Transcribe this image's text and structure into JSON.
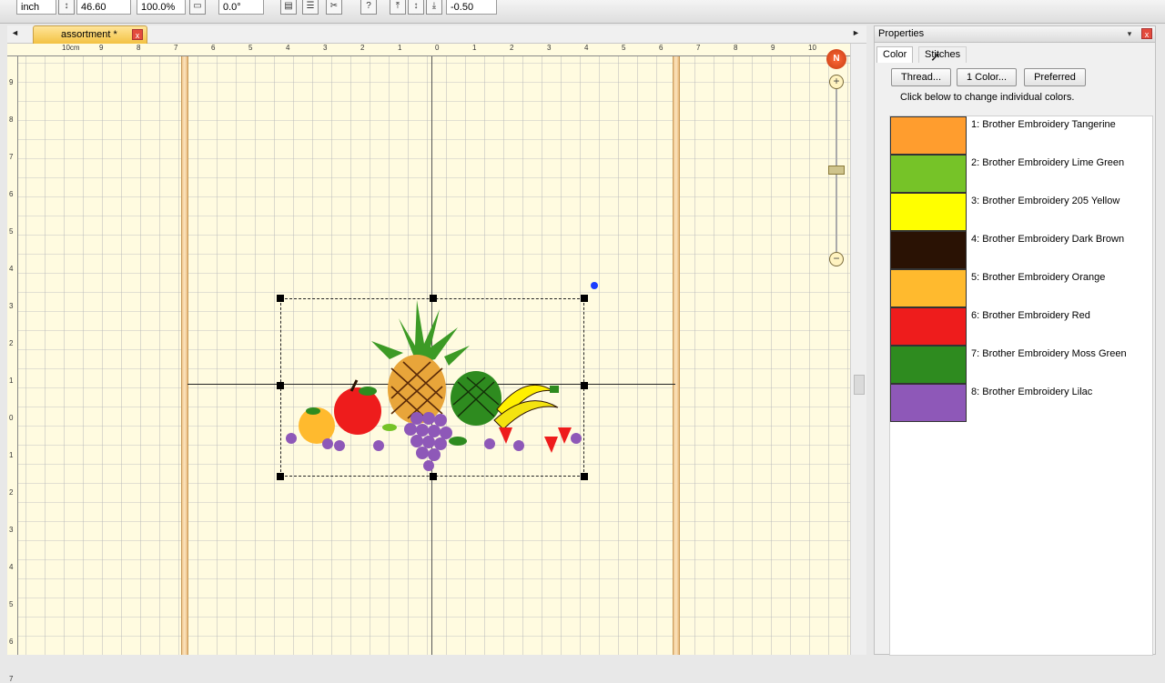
{
  "toolbar": {
    "unit_label": "inch",
    "field_width": "46.60",
    "field_zoom": "100.0%",
    "field_angle": "0.0°",
    "field_offset": "-0.50"
  },
  "document": {
    "tab_title": "assortment *",
    "tab_close": "x"
  },
  "ruler": {
    "top_ticks": [
      "10cm",
      "9",
      "8",
      "7",
      "6",
      "5",
      "4",
      "3",
      "2",
      "1",
      "0",
      "1",
      "2",
      "3",
      "4",
      "5",
      "6",
      "7",
      "8",
      "9",
      "10"
    ],
    "left_ticks": [
      "9",
      "8",
      "7",
      "6",
      "5",
      "4",
      "3",
      "2",
      "1",
      "0",
      "1",
      "2",
      "3",
      "4",
      "5",
      "6",
      "7"
    ]
  },
  "zoom": {
    "plus": "+",
    "minus": "−",
    "north": "N"
  },
  "properties": {
    "title": "Properties",
    "tabs": {
      "color": "Color",
      "stitches": "Stitches"
    },
    "buttons": {
      "thread": "Thread...",
      "one_color": "1 Color...",
      "preferred": "Preferred"
    },
    "hint": "Click below to change individual colors.",
    "colors": [
      {
        "label": "1: Brother Embroidery Tangerine",
        "hex": "#ff9d2e"
      },
      {
        "label": "2: Brother Embroidery Lime Green",
        "hex": "#76c328"
      },
      {
        "label": "3: Brother Embroidery 205 Yellow",
        "hex": "#ffff00"
      },
      {
        "label": "4: Brother Embroidery Dark Brown",
        "hex": "#2a1204"
      },
      {
        "label": "5: Brother Embroidery Orange",
        "hex": "#ffba2e"
      },
      {
        "label": "6: Brother Embroidery Red",
        "hex": "#ee1c1c"
      },
      {
        "label": "7: Brother Embroidery Moss Green",
        "hex": "#2e8b1f"
      },
      {
        "label": "8: Brother Embroidery Lilac",
        "hex": "#8e58b8"
      }
    ]
  }
}
